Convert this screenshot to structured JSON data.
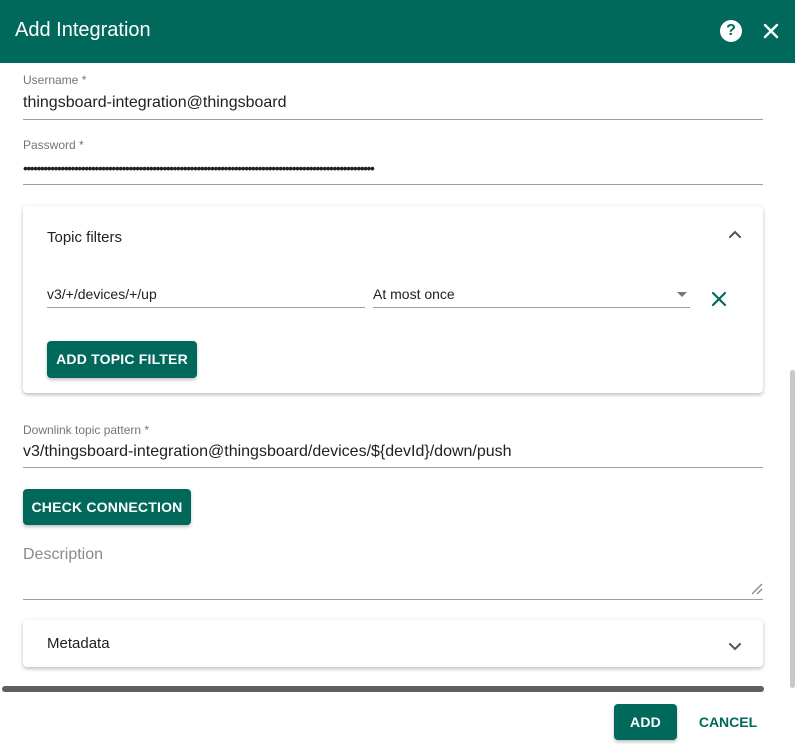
{
  "dialog": {
    "title": "Add Integration"
  },
  "credentials": {
    "username_label": "Username *",
    "username_value": "thingsboard-integration@thingsboard",
    "password_label": "Password *",
    "password_value": "•••••••••••••••••••••••••••••••••••••••••••••••••••••••••••••••••••••••••••••••••••••••••••••••••••••••"
  },
  "topic_filters": {
    "title": "Topic filters",
    "rows": [
      {
        "topic": "v3/+/devices/+/up",
        "qos": "At most once"
      }
    ],
    "add_button": "ADD TOPIC FILTER"
  },
  "downlink": {
    "label": "Downlink topic pattern *",
    "value": "v3/thingsboard-integration@thingsboard/devices/${devId}/down/push"
  },
  "check_connection_button": "CHECK CONNECTION",
  "description": {
    "placeholder": "Description"
  },
  "metadata": {
    "title": "Metadata"
  },
  "footer": {
    "add_button": "ADD",
    "cancel_button": "CANCEL"
  },
  "colors": {
    "primary": "#00695c",
    "text": "#212121",
    "label": "#757575"
  }
}
